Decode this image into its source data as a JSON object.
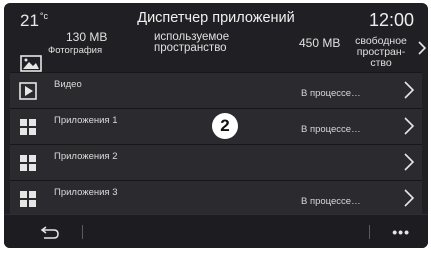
{
  "header": {
    "temperature": "21",
    "temperature_unit": "°c",
    "title": "Диспетчер приложений",
    "clock": "12:00"
  },
  "storage": {
    "category_size": "130 MB",
    "category_label": "Фотография",
    "used_label_line1": "используемое",
    "used_label_line2": "пространство",
    "free_size": "450 MB",
    "free_label_line1": "свободное",
    "free_label_line2": "простран-",
    "free_label_line3": "ство"
  },
  "rows": [
    {
      "name": "Видео",
      "status": "В процессе…",
      "icon": "video-icon"
    },
    {
      "name": "Приложения 1",
      "status": "В процессе…",
      "icon": "apps-grid-icon"
    },
    {
      "name": "Приложения 2",
      "status": "",
      "icon": "apps-grid-icon"
    },
    {
      "name": "Приложения 3",
      "status": "В процессе…",
      "icon": "apps-grid-icon"
    }
  ],
  "callout_number": "2",
  "bottombar": {
    "back_icon": "back-arrow-icon",
    "more_label": "•••"
  }
}
